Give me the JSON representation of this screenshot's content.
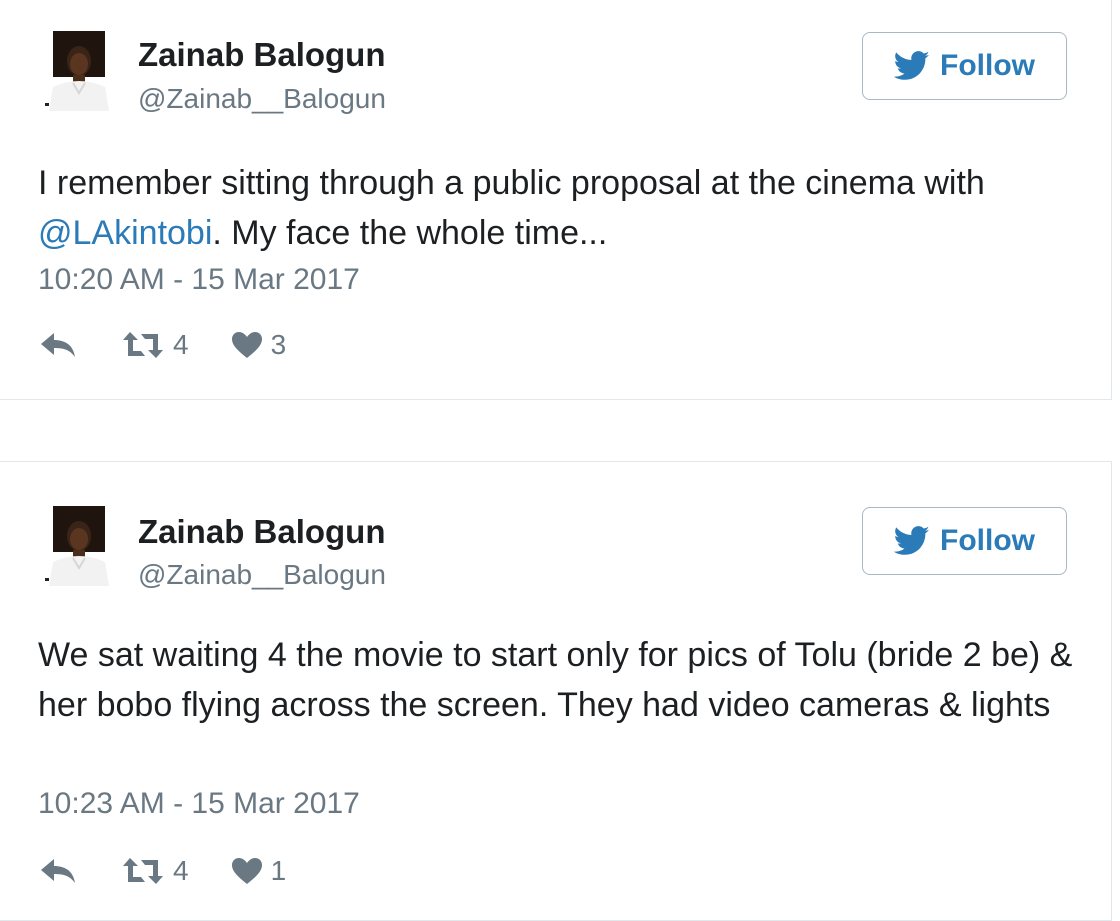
{
  "accent_color": "#2b7bb9",
  "tweets": [
    {
      "name": "Zainab Balogun",
      "handle": "@Zainab__Balogun",
      "follow_label": "Follow",
      "text_before": "I remember sitting through a public proposal at the cinema with ",
      "mention": "@LAkintobi",
      "text_after": ". My face the whole time...",
      "timestamp": "10:20 AM - 15 Mar 2017",
      "retweets": "4",
      "likes": "3",
      "icons": [
        "twitter-bird-icon",
        "reply-icon",
        "retweet-icon",
        "heart-icon"
      ]
    },
    {
      "name": "Zainab Balogun",
      "handle": "@Zainab__Balogun",
      "follow_label": "Follow",
      "text_before": "We sat waiting 4 the movie to start only for pics of Tolu (bride 2 be) & her bobo flying across the screen. They had video cameras & lights",
      "mention": "",
      "text_after": "",
      "timestamp": "10:23 AM - 15 Mar 2017",
      "retweets": "4",
      "likes": "1",
      "icons": [
        "twitter-bird-icon",
        "reply-icon",
        "retweet-icon",
        "heart-icon"
      ]
    }
  ]
}
